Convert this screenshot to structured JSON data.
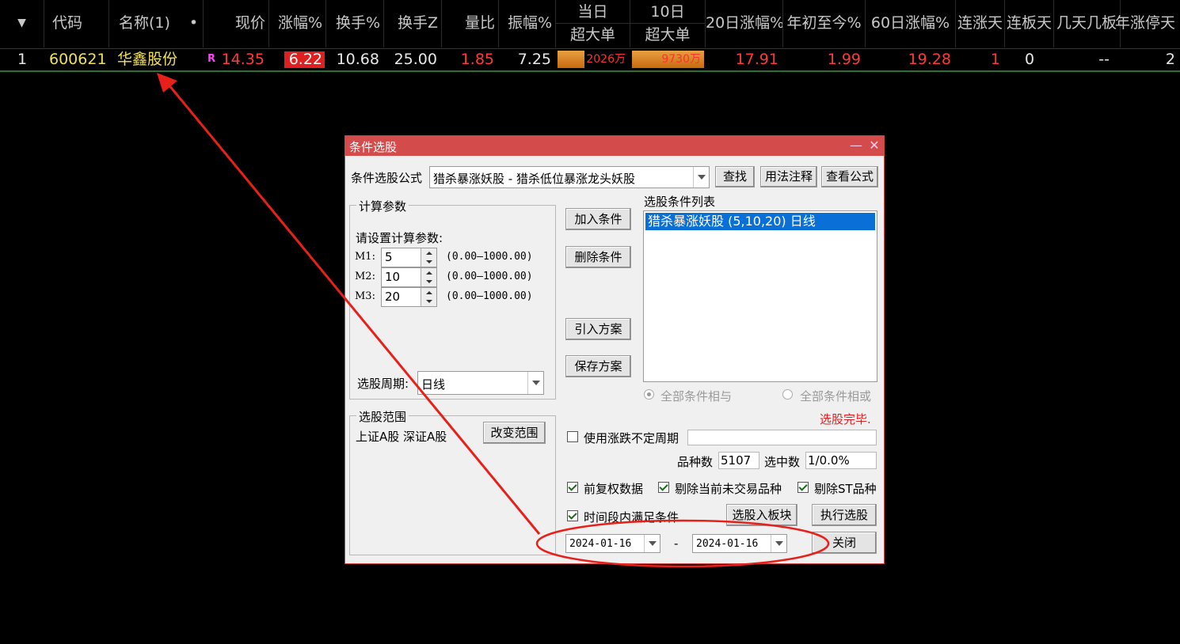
{
  "table": {
    "headers": {
      "menu_arrow": "▼",
      "code": "代码",
      "name": "名称(1)",
      "dot": "•",
      "price": "现价",
      "change_pct": "涨幅%",
      "turnover": "换手%",
      "turnover_z": "换手Z",
      "volume_ratio": "量比",
      "amplitude": "振幅%",
      "today_top": "当日",
      "today_bottom": "超大单",
      "ten_day_top": "10日",
      "ten_day_bottom": "超大单",
      "twenty_day": "20日涨幅%",
      "ytd": "年初至今%",
      "sixty_day": "60日涨幅%",
      "consec_up": "连涨天",
      "consec_limit": "连板天",
      "days_boards": "几天几板",
      "year_limit_days": "年涨停天"
    },
    "rows": [
      {
        "index": "1",
        "code": "600621",
        "name": "华鑫股份",
        "flag": "R",
        "price": "14.35",
        "change_pct": "6.22",
        "turnover": "10.68",
        "turnover_z": "25.00",
        "volume_ratio": "1.85",
        "amplitude": "7.25",
        "today_super": "2026万",
        "today_super_fill": 0.38,
        "ten_day_super": "9730万",
        "ten_day_super_fill": 1.0,
        "twenty_day": "17.91",
        "ytd": "1.99",
        "sixty_day": "19.28",
        "consec_up": "1",
        "consec_limit": "0",
        "days_boards": "--",
        "year_limit_days": "2"
      }
    ]
  },
  "dialog": {
    "title": "条件选股",
    "minimize": "—",
    "close_x": "✕",
    "formula_label": "条件选股公式",
    "formula_value": "猎杀暴涨妖股 - 猎杀低位暴涨龙头妖股",
    "find_btn": "查找",
    "usage_btn": "用法注释",
    "view_formula_btn": "查看公式",
    "calc_params_title": "计算参数",
    "set_params_label": "请设置计算参数:",
    "params": [
      {
        "label": "M1:",
        "value": "5",
        "range": "(0.00—1000.00)"
      },
      {
        "label": "M2:",
        "value": "10",
        "range": "(0.00—1000.00)"
      },
      {
        "label": "M3:",
        "value": "20",
        "range": "(0.00—1000.00)"
      }
    ],
    "period_label": "选股周期:",
    "period_value": "日线",
    "add_cond_btn": "加入条件",
    "del_cond_btn": "删除条件",
    "import_plan_btn": "引入方案",
    "save_plan_btn": "保存方案",
    "cond_list_title": "选股条件列表",
    "cond_items": [
      "猎杀暴涨妖股 (5,10,20) 日线"
    ],
    "all_and": "全部条件相与",
    "all_or": "全部条件相或",
    "done_text": "选股完毕.",
    "scope_title": "选股范围",
    "scope_value": "上证A股 深证A股",
    "change_scope_btn": "改变范围",
    "use_uncertain_period": "使用涨跌不定周期",
    "count_label": "品种数",
    "count_value": "5107",
    "selected_label": "选中数",
    "selected_value": "1/0.0%",
    "fq_data": "前复权数据",
    "exclude_no_trade": "剔除当前未交易品种",
    "exclude_st": "剔除ST品种",
    "time_range_cond": "时间段内满足条件",
    "to_block_btn": "选股入板块",
    "execute_btn": "执行选股",
    "start_date": "2024-01-16",
    "date_sep": "-",
    "end_date": "2024-01-16",
    "close_btn": "关闭"
  },
  "colors": {
    "annotation": "#e8201a",
    "title_bar": "#d34b4b",
    "selection": "#0a6fd6"
  }
}
